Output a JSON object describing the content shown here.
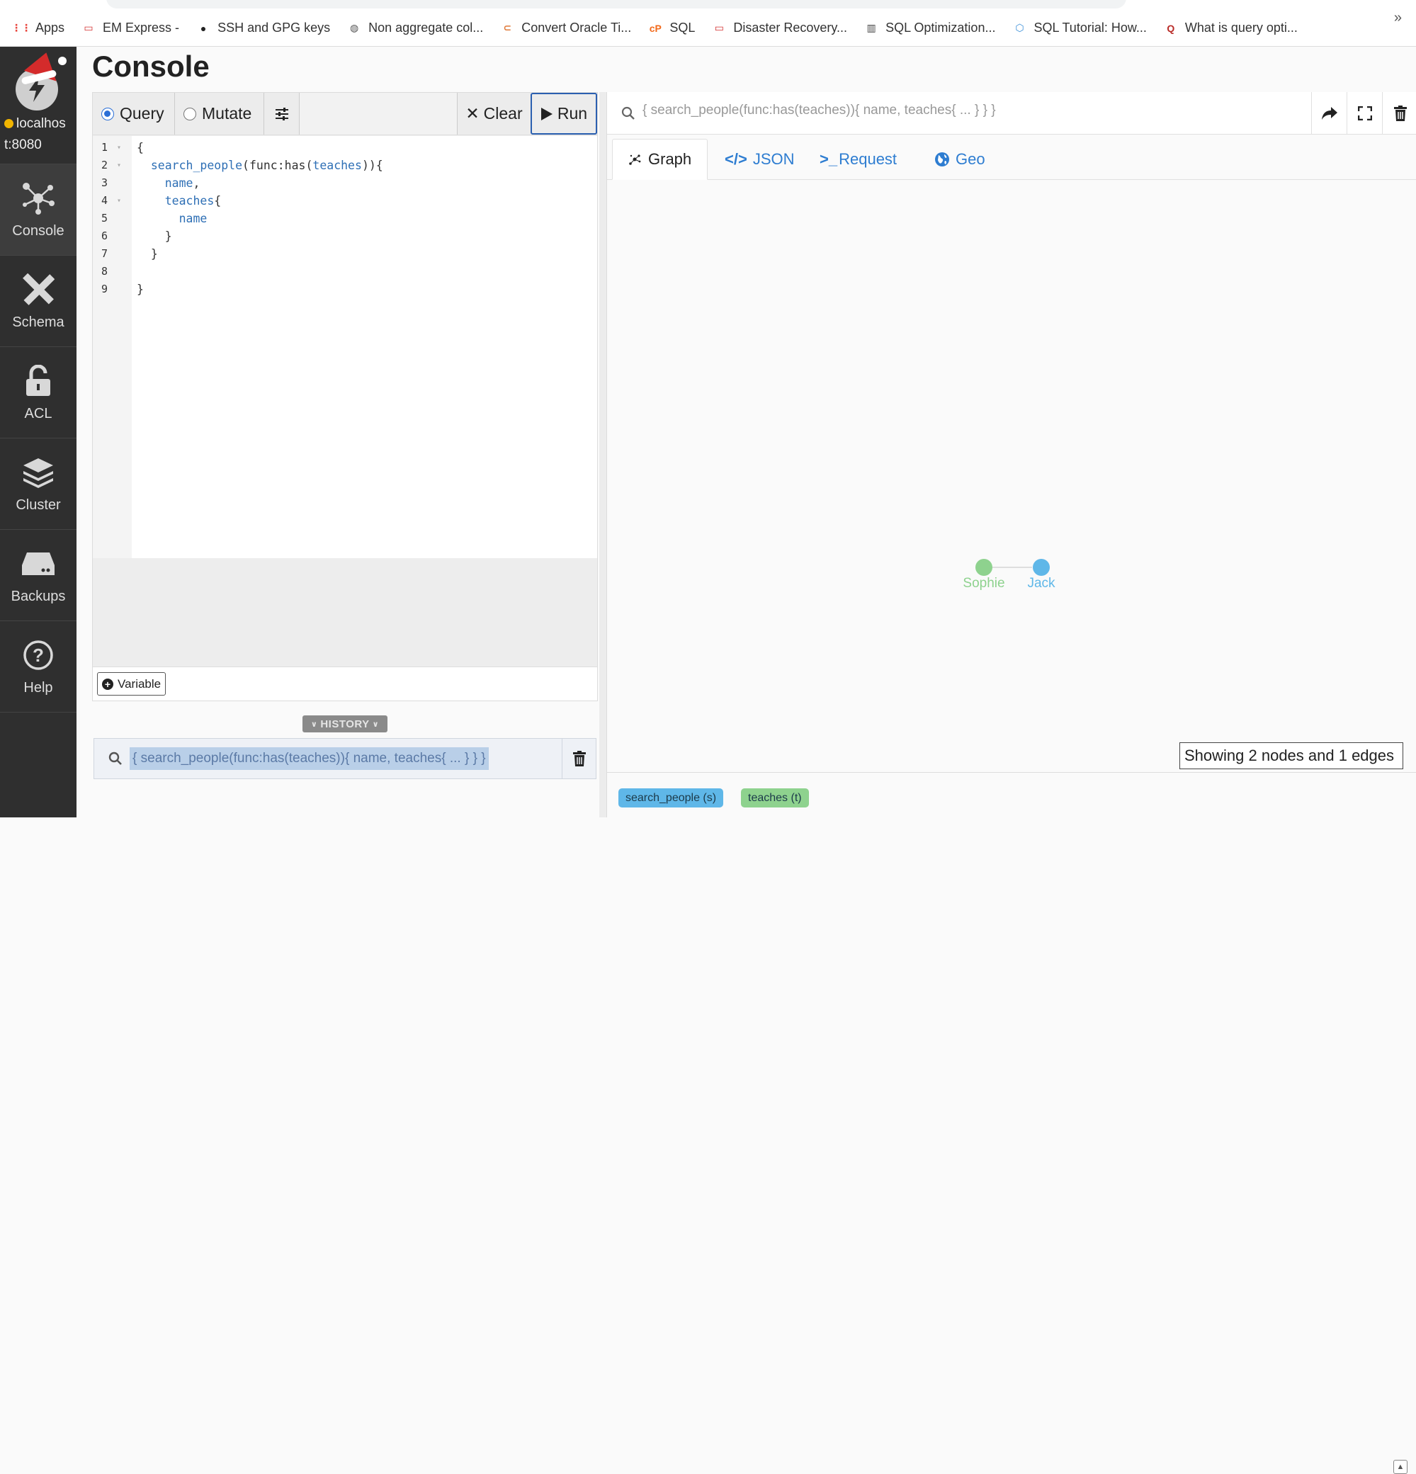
{
  "bookmarks": [
    {
      "label": "Apps",
      "icon": "apps-grid-icon",
      "color": "#e8453c"
    },
    {
      "label": "EM Express -",
      "icon": "oracle-icon",
      "color": "#d32f2f"
    },
    {
      "label": "SSH and GPG keys",
      "icon": "github-icon",
      "color": "#222222"
    },
    {
      "label": "Non aggregate col...",
      "icon": "globe-icon",
      "color": "#555555"
    },
    {
      "label": "Convert Oracle Ti...",
      "icon": "convert-icon",
      "color": "#e07a3a"
    },
    {
      "label": "SQL",
      "icon": "cpanel-icon",
      "color": "#f26a1b"
    },
    {
      "label": "Disaster Recovery...",
      "icon": "oracle-icon",
      "color": "#d32f2f"
    },
    {
      "label": "SQL Optimization...",
      "icon": "book-icon",
      "color": "#444444"
    },
    {
      "label": "SQL Tutorial: How...",
      "icon": "shield-icon",
      "color": "#3a8fd8"
    },
    {
      "label": "What is query opti...",
      "icon": "quora-icon",
      "color": "#b92b27"
    }
  ],
  "bookmarks_more": "»",
  "sidebar": {
    "host_line1": "localhos",
    "host_line2": "t:8080",
    "status_color": "#f0b400",
    "items": [
      {
        "label": "Console",
        "icon": "graph-nodes-icon",
        "active": true
      },
      {
        "label": "Schema",
        "icon": "pencil-ruler-icon",
        "active": false
      },
      {
        "label": "ACL",
        "icon": "unlock-icon",
        "active": false
      },
      {
        "label": "Cluster",
        "icon": "layers-icon",
        "active": false
      },
      {
        "label": "Backups",
        "icon": "drive-icon",
        "active": false
      },
      {
        "label": "Help",
        "icon": "question-circle-icon",
        "active": false
      }
    ]
  },
  "page_title": "Console",
  "editor": {
    "query_label": "Query",
    "mutate_label": "Mutate",
    "clear_label": "Clear",
    "run_label": "Run",
    "lines": [
      {
        "num": "1",
        "text": "{",
        "fold": true
      },
      {
        "num": "2",
        "text": "  search_people(func:has(teaches)){",
        "fold": true
      },
      {
        "num": "3",
        "text": "    name,",
        "fold": false
      },
      {
        "num": "4",
        "text": "    teaches{",
        "fold": true
      },
      {
        "num": "5",
        "text": "      name",
        "fold": false
      },
      {
        "num": "6",
        "text": "    }",
        "fold": false
      },
      {
        "num": "7",
        "text": "  }",
        "fold": false
      },
      {
        "num": "8",
        "text": "",
        "fold": false
      },
      {
        "num": "9",
        "text": "}",
        "fold": false
      }
    ],
    "variable_label": "Variable"
  },
  "history": {
    "tag": "HISTORY",
    "entry": "{ search_people(func:has(teaches)){ name, teaches{ ... } } }"
  },
  "result": {
    "search_text": "{ search_people(func:has(teaches)){ name, teaches{ ... } } }",
    "tabs": [
      {
        "label": "Graph",
        "icon": "graph-icon",
        "active": true
      },
      {
        "label": "JSON",
        "icon": "code-icon",
        "active": false
      },
      {
        "label": "Request",
        "icon": "terminal-icon",
        "active": false
      },
      {
        "label": "Geo",
        "icon": "globe-icon",
        "active": false
      }
    ],
    "nodes": [
      {
        "label": "Sophie",
        "color": "#8ed28e"
      },
      {
        "label": "Jack",
        "color": "#5fb7e8"
      }
    ],
    "status": "Showing 2 nodes and 1 edges",
    "legend": [
      {
        "label": "search_people (s)",
        "color": "#5fb7e8"
      },
      {
        "label": "teaches (t)",
        "color": "#8ed28e"
      }
    ]
  }
}
